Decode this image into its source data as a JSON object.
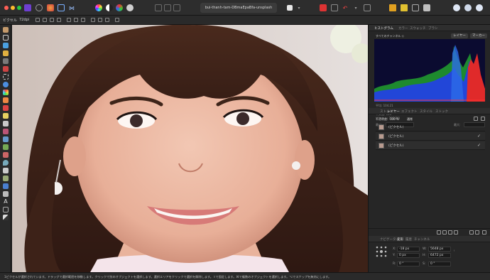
{
  "document": {
    "tab_title": "bui-thanh-tam-DBmaEpaBfa-unsplash"
  },
  "context_toolbar": {
    "unit_label": "ピクセル",
    "dpi_label": "72dpi"
  },
  "histogram_panel": {
    "tabs": [
      "ヒストグラム",
      "カラー",
      "スウォッチ",
      "ブラシ"
    ],
    "channel_select": "すべてのチャンネル ◇",
    "layer_button": "レイヤー",
    "marker_button": "マーカー",
    "stats": {
      "mean": "平均: 104.21",
      "stddev": "標準偏差: 46.87",
      "median": "中央値: 116",
      "pixels": "ピクセル: 215029"
    },
    "bottom_labels": [
      "最小:",
      "最大:"
    ]
  },
  "layers_panel": {
    "tabs": [
      "ストック",
      "レイヤー",
      "エフェクト",
      "スタイル",
      "ストック"
    ],
    "opacity_label": "不透明度:",
    "opacity_value": "100 %",
    "blend_mode": "通常",
    "layers": [
      {
        "name": "(ピクセル)",
        "visible": ""
      },
      {
        "name": "(ピクセル)",
        "visible": "✓"
      },
      {
        "name": "(ピクセル)",
        "visible": "✓"
      }
    ]
  },
  "transform_panel": {
    "tabs": [
      "ナビゲーター",
      "変形",
      "履歴",
      "チャンネル"
    ],
    "x_label": "X:",
    "x_value": "-18 px",
    "y_label": "Y:",
    "y_value": "0 px",
    "w_label": "W:",
    "w_value": "5648 px",
    "h_label": "H:",
    "h_value": "6472 px",
    "r_label": "R:",
    "r_value": "0 °",
    "s_label": "S:",
    "s_value": "0 °"
  },
  "status_bar": {
    "text": "1ピクセルが選択されています。ドラッグで選択範囲を移動します。クリックで別のオブジェクトを選択します。選択エリアをクリックで選択を解除します。⇧で固定します。⌘で複数のオブジェクトを選択します。⌥でスナップを無効にします。"
  },
  "colors": {
    "accent_purple": "#6d3fd0",
    "close": "#ff5f57",
    "minimize": "#febc2e",
    "zoom": "#28c840"
  }
}
